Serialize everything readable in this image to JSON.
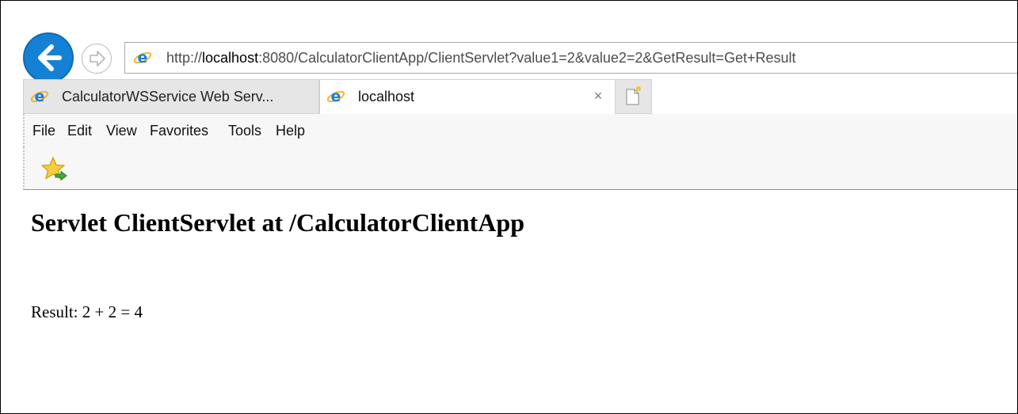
{
  "browser": {
    "address_bar": {
      "url_prefix": "http://",
      "url_host": "localhost",
      "url_rest": ":8080/CalculatorClientApp/ClientServlet?value1=2&value2=2&GetResult=Get+Result"
    },
    "tabs": [
      {
        "label": "CalculatorWSService Web Serv...",
        "active": false,
        "icon": "ie-icon"
      },
      {
        "label": "localhost",
        "active": true,
        "icon": "ie-icon"
      }
    ],
    "tab_close_glyph": "×",
    "menu": [
      "File",
      "Edit",
      "View",
      "Favorites",
      "Tools",
      "Help"
    ],
    "colors": {
      "accent": "#1581d4",
      "ie_blue": "#1a7fd6"
    }
  },
  "page": {
    "title": "Servlet ClientServlet at /CalculatorClientApp",
    "result": "Result: 2 + 2 = 4"
  }
}
